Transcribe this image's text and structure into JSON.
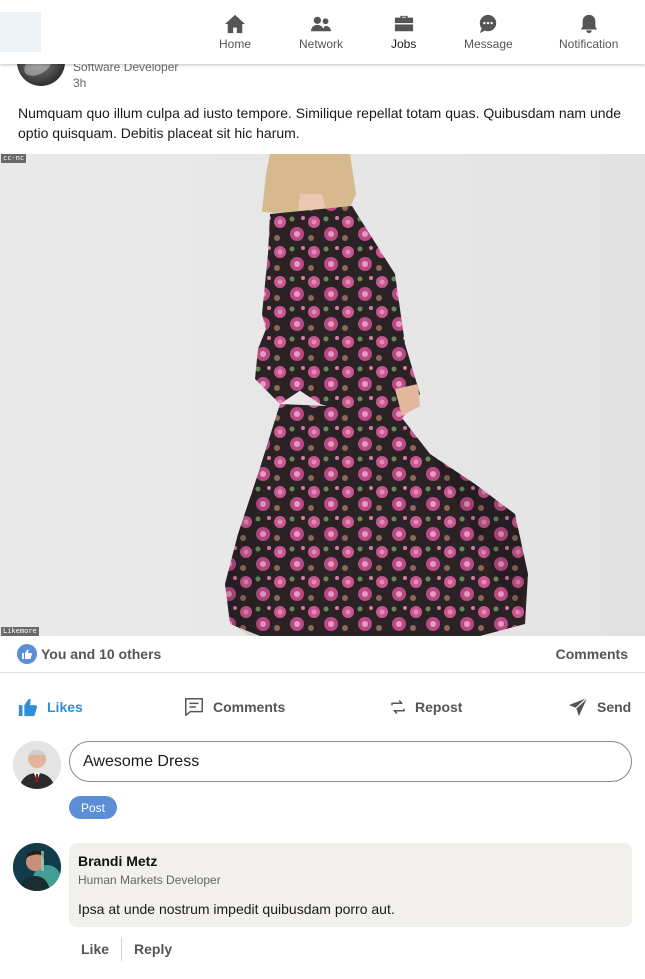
{
  "nav": {
    "items": [
      {
        "label": "Home",
        "icon": "home-icon"
      },
      {
        "label": "Network",
        "icon": "network-icon"
      },
      {
        "label": "Jobs",
        "icon": "briefcase-icon"
      },
      {
        "label": "Message",
        "icon": "message-icon"
      },
      {
        "label": "Notification",
        "icon": "bell-icon"
      }
    ],
    "active": "Jobs"
  },
  "post": {
    "author_role": "Software Developer",
    "time": "3h",
    "text": "Numquam quo illum culpa ad iusto tempore. Similique repellat totam quas. Quibusdam nam unde optio quisquam. Debitis placeat sit hic harum.",
    "image_tag_top": "cc-nc",
    "image_tag_bottom": "Likemore",
    "reactions_text": "You and 10 others",
    "comments_count": "Comments"
  },
  "actions": {
    "likes": "Likes",
    "comments": "Comments",
    "repost": "Repost",
    "send": "Send"
  },
  "comment_box": {
    "value": "Awesome Dress",
    "post_label": "Post"
  },
  "reply": {
    "name": "Brandi Metz",
    "role": "Human Markets Developer",
    "text": "Ipsa at unde nostrum impedit quibusdam porro aut.",
    "like_label": "Like",
    "reply_label": "Reply"
  },
  "colors": {
    "accent": "#2f8fd8",
    "button_blue": "#5b8ed6",
    "card_bg": "#f2f0ed"
  }
}
